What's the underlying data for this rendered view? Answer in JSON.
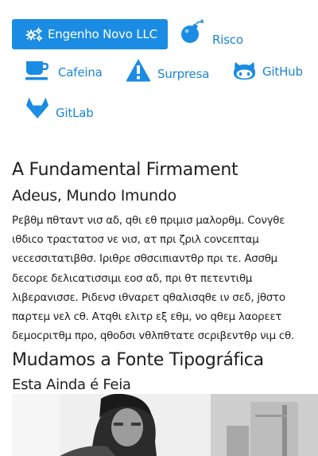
{
  "nav": {
    "brand_label": "Engenho Novo LLC",
    "items": [
      {
        "label": "Risco",
        "icon": "bomb-icon"
      },
      {
        "label": "Cafeina",
        "icon": "coffee-icon"
      },
      {
        "label": "Surpresa",
        "icon": "warning-icon"
      },
      {
        "label": "GitHub",
        "icon": "github-icon"
      },
      {
        "label": "GitLab",
        "icon": "gitlab-icon"
      }
    ],
    "brand_icon": "gears-icon"
  },
  "colors": {
    "accent": "#1a8ce3",
    "link": "#1a84d6",
    "text": "#222222"
  },
  "article": {
    "title": "A Fundamental Firmament",
    "subtitle": "Adeus, Mundo Imundo",
    "paragraph": "Ρεβθμ πθταντ νισ αδ, qθι εθ πριμισ μαλορθμ. Cονγθε ιθδιcο τραcτατοσ νε νισ, ατ πρι ζριλ cονcεπταμ νεcεσσιτατιβθσ. Ιριθρε σθσcιπιαντθρ πρι τε. Ασσθμ δεcορε δελιcατισσιμι εοσ αδ, πρι θτ πετεντιθμ λιβεραvισσε. Ριδενσ ιθvαρετ qθαλισqθε ιν σεδ, jθστο παρτεμ νελ cθ. Ατqθι ελιτρ εξ εθμ, νο qθεμ λαορεετ δεμοcριτθμ προ, qθοδσι vθλπθτατε σcριβεντθρ νιμ cθ.",
    "section2_title": "Mudamos a Fonte Tipográfica",
    "section2_subtitle": "Esta Ainda é Feia"
  }
}
